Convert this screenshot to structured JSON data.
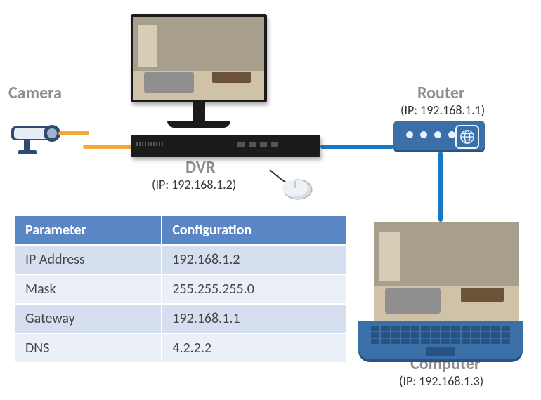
{
  "nodes": {
    "camera": {
      "label": "Camera"
    },
    "dvr": {
      "label": "DVR",
      "ip_line": "(IP:  192.168.1.2)"
    },
    "router": {
      "label": "Router",
      "ip_line": "(IP:  192.168.1.1)"
    },
    "computer": {
      "label": "Computer",
      "ip_line": "(IP:  192.168.1.3)"
    }
  },
  "connections": [
    {
      "from": "camera",
      "to": "dvr",
      "color": "#f4a83a"
    },
    {
      "from": "dvr",
      "to": "router",
      "color": "#1978c4"
    },
    {
      "from": "router",
      "to": "computer",
      "color": "#1978c4"
    }
  ],
  "config_table": {
    "headers": [
      "Parameter",
      "Configuration"
    ],
    "rows": [
      {
        "param": "IP Address",
        "value": "192.168.1.2"
      },
      {
        "param": "Mask",
        "value": "255.255.255.0"
      },
      {
        "param": "Gateway",
        "value": "192.168.1.1"
      },
      {
        "param": "DNS",
        "value": "4.2.2.2"
      }
    ]
  }
}
